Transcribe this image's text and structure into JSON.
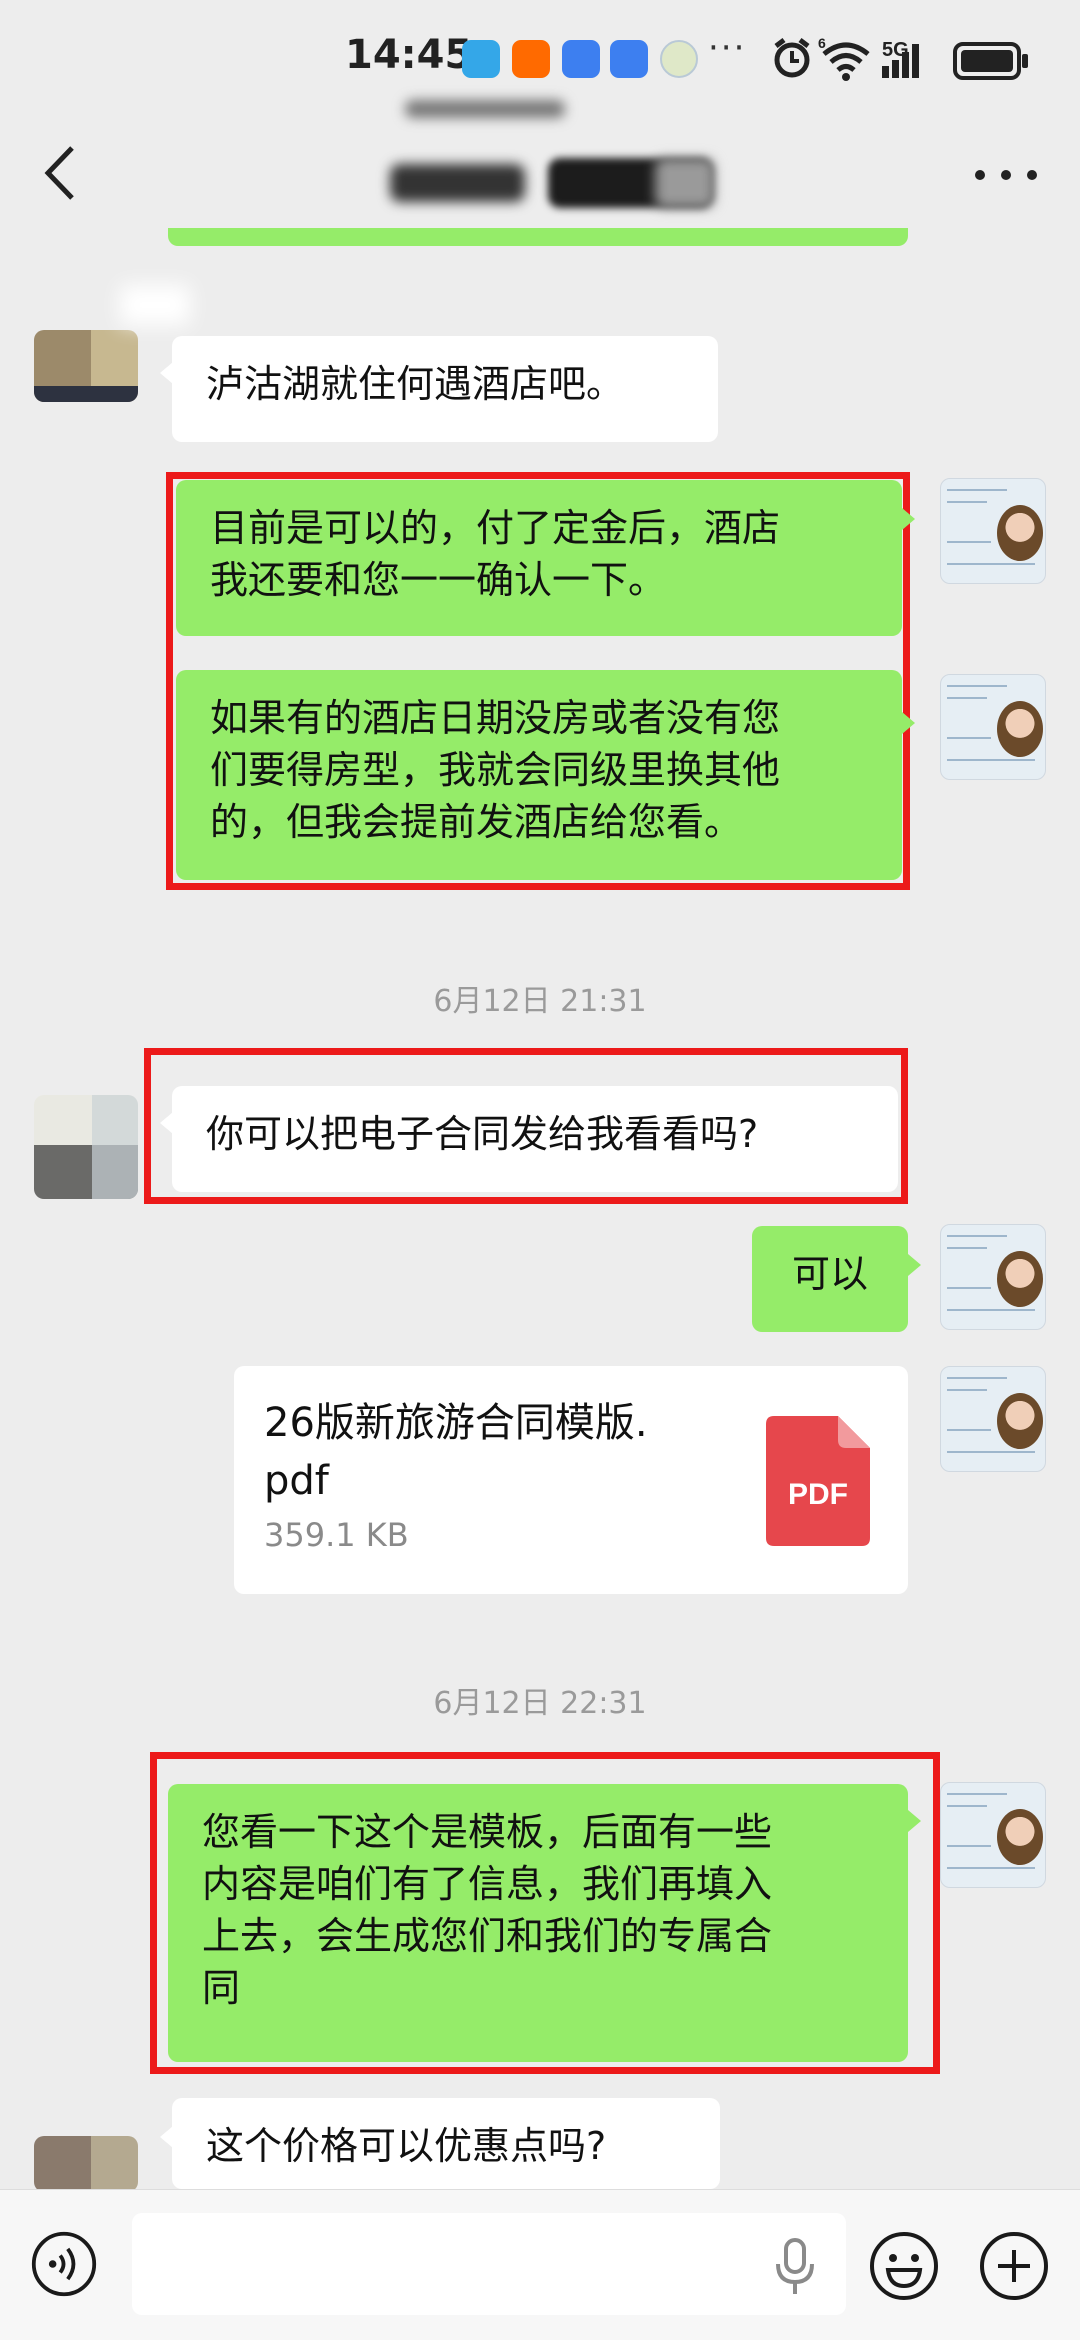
{
  "status_bar": {
    "time": "14:45",
    "more": "···",
    "network": "5G",
    "network_sup": "6"
  },
  "header": {
    "back_icon": "chevron-left-icon",
    "more_icon": "more-horizontal-icon"
  },
  "messages": {
    "m1": "泸沽湖就住何遇酒店吧。",
    "m2a": "目前是可以的，付了定金后，酒店",
    "m2b": "我还要和您一一确认一下。",
    "m3a": "如果有的酒店日期没房或者没有您",
    "m3b": "们要得房型，我就会同级里换其他",
    "m3c": "的，但我会提前发酒店给您看。",
    "ts1": "6月12日 21:31",
    "m4": "你可以把电子合同发给我看看吗?",
    "m5": "可以",
    "file_name_a": "26版新旅游合同模版.",
    "file_name_b": "pdf",
    "file_size": "359.1 KB",
    "file_badge": "PDF",
    "ts2": "6月12日 22:31",
    "m6a": "您看一下这个是模板，后面有一些",
    "m6b": "内容是咱们有了信息，我们再填入",
    "m6c": "上去，会生成您们和我们的专属合",
    "m6d": "同",
    "m7": "这个价格可以优惠点吗?"
  },
  "input_bar": {
    "placeholder": "",
    "voice_icon": "voice-toggle-icon",
    "mic_icon": "microphone-icon",
    "emoji_icon": "emoji-icon",
    "plus_icon": "plus-icon"
  },
  "colors": {
    "background": "#ededed",
    "my_bubble": "#95ec69",
    "their_bubble": "#ffffff",
    "highlight_box": "#ec1a1a",
    "pdf_badge": "#e6474c"
  }
}
